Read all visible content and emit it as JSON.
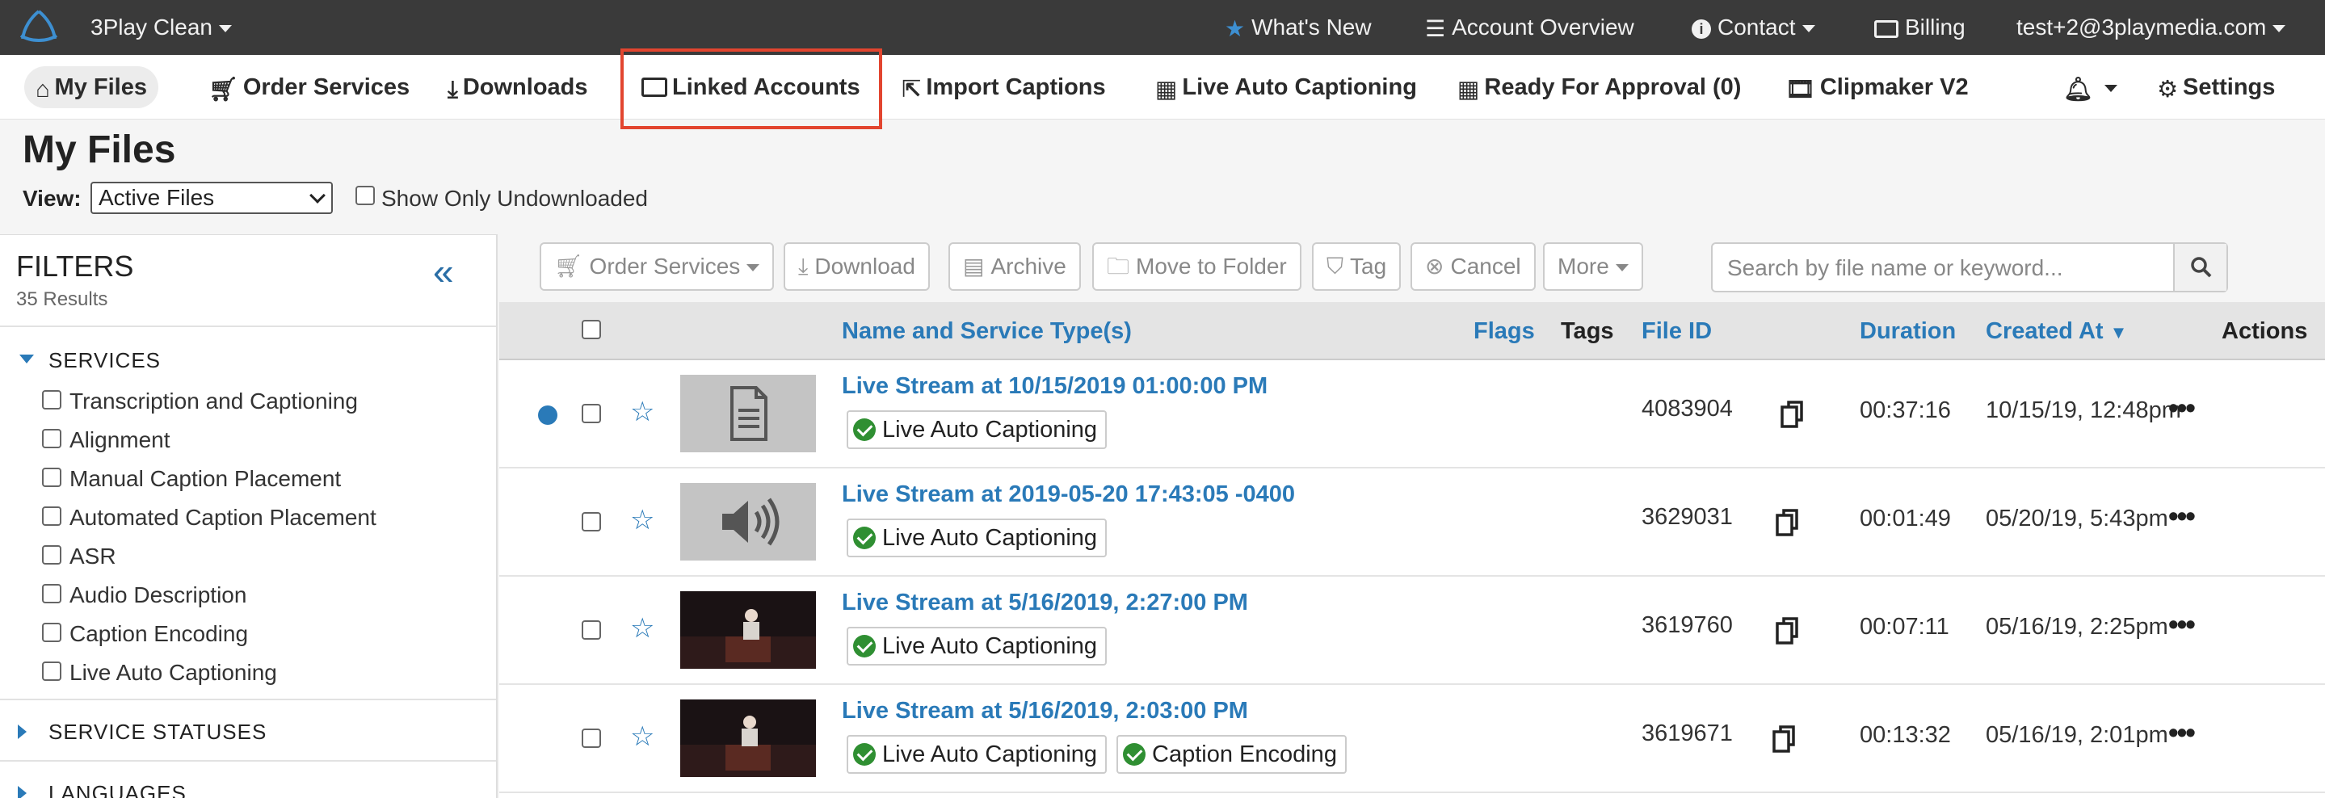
{
  "topbar": {
    "app_name": "3Play Clean",
    "whats_new": "What's New",
    "account_overview": "Account Overview",
    "contact": "Contact",
    "billing": "Billing",
    "user": "test+2@3playmedia.com"
  },
  "nav": {
    "my_files": "My Files",
    "order_services": "Order Services",
    "downloads": "Downloads",
    "linked_accounts": "Linked Accounts",
    "import_captions": "Import Captions",
    "live_auto_captioning": "Live Auto Captioning",
    "ready_for_approval": "Ready For Approval (0)",
    "clipmaker": "Clipmaker V2",
    "settings": "Settings"
  },
  "page": {
    "title": "My Files",
    "view_label": "View:",
    "view_value": "Active Files",
    "show_only_undownloaded": "Show Only Undownloaded"
  },
  "sidebar": {
    "title": "FILTERS",
    "results": "35 Results",
    "services_header": "SERVICES",
    "services": [
      "Transcription and Captioning",
      "Alignment",
      "Manual Caption Placement",
      "Automated Caption Placement",
      "ASR",
      "Audio Description",
      "Caption Encoding",
      "Live Auto Captioning"
    ],
    "service_statuses_header": "SERVICE STATUSES",
    "languages_header": "LANGUAGES"
  },
  "toolbar": {
    "order_services": "Order Services",
    "download": "Download",
    "archive": "Archive",
    "move_to_folder": "Move to Folder",
    "tag": "Tag",
    "cancel": "Cancel",
    "more": "More",
    "search_placeholder": "Search by file name or keyword..."
  },
  "table": {
    "headers": {
      "name": "Name and Service Type(s)",
      "flags": "Flags",
      "tags": "Tags",
      "file_id": "File ID",
      "duration": "Duration",
      "created_at": "Created At",
      "actions": "Actions"
    },
    "rows": [
      {
        "name": "Live Stream at 10/15/2019 01:00:00 PM",
        "services": [
          "Live Auto Captioning"
        ],
        "file_id": "4083904",
        "duration": "00:37:16",
        "created": "10/15/19, 12:48pm",
        "thumb": "document",
        "unread": true
      },
      {
        "name": "Live Stream at 2019-05-20 17:43:05 -0400",
        "services": [
          "Live Auto Captioning"
        ],
        "file_id": "3629031",
        "duration": "00:01:49",
        "created": "05/20/19, 5:43pm",
        "thumb": "audio",
        "unread": false
      },
      {
        "name": "Live Stream at 5/16/2019, 2:27:00 PM",
        "services": [
          "Live Auto Captioning"
        ],
        "file_id": "3619760",
        "duration": "00:07:11",
        "created": "05/16/19, 2:25pm",
        "thumb": "video",
        "unread": false
      },
      {
        "name": "Live Stream at 5/16/2019, 2:03:00 PM",
        "services": [
          "Live Auto Captioning",
          "Caption Encoding"
        ],
        "file_id": "3619671",
        "duration": "00:13:32",
        "created": "05/16/19, 2:01pm",
        "thumb": "video",
        "unread": false
      }
    ]
  },
  "colors": {
    "accent": "#2a7ab8",
    "topbar": "#3a3a3a",
    "highlight": "#e2452f",
    "success": "#2f8f32"
  }
}
